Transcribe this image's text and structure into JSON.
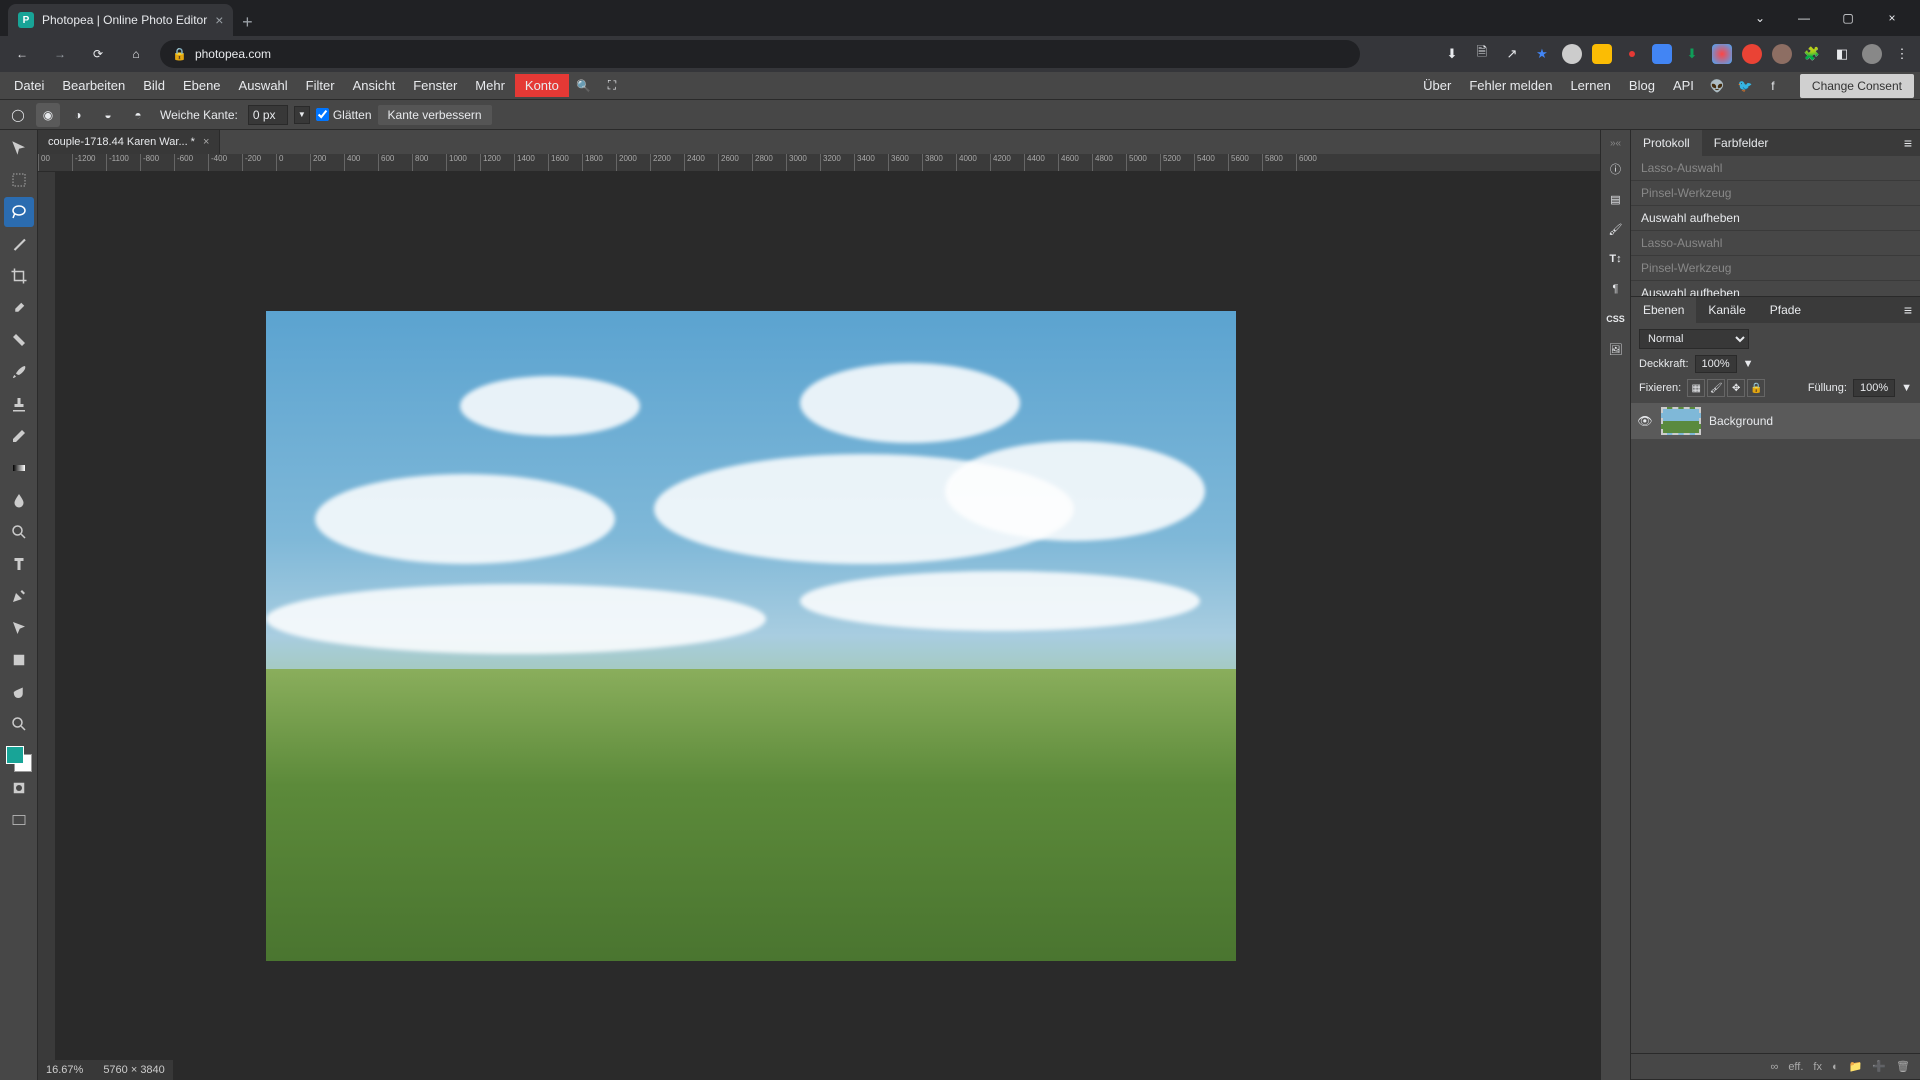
{
  "browser": {
    "tab_title": "Photopea | Online Photo Editor",
    "url": "photopea.com"
  },
  "menu": {
    "items": [
      "Datei",
      "Bearbeiten",
      "Bild",
      "Ebene",
      "Auswahl",
      "Filter",
      "Ansicht",
      "Fenster",
      "Mehr"
    ],
    "konto": "Konto",
    "right": [
      "Über",
      "Fehler melden",
      "Lernen",
      "Blog",
      "API"
    ],
    "consent": "Change Consent"
  },
  "options": {
    "feather_label": "Weiche Kante:",
    "feather_value": "0 px",
    "smooth_label": "Glätten",
    "refine": "Kante verbessern"
  },
  "doc": {
    "tab": "couple-1718.44 Karen War... *",
    "ruler_h": [
      "00",
      "-1200",
      "-1100",
      "-800",
      "-600",
      "-400",
      "-200",
      "0",
      "200",
      "400",
      "600",
      "800",
      "1000",
      "1200",
      "1400",
      "1600",
      "1800",
      "2000",
      "2200",
      "2400",
      "2600",
      "2800",
      "3000",
      "3200",
      "3400",
      "3600",
      "3800",
      "4000",
      "4200",
      "4400",
      "4600",
      "4800",
      "5000",
      "5200",
      "5400",
      "5600",
      "5800",
      "6000"
    ]
  },
  "status": {
    "zoom": "16.67%",
    "dims": "5760 × 3840"
  },
  "panels": {
    "history_tabs": [
      "Protokoll",
      "Farbfelder"
    ],
    "history": [
      {
        "label": "Lasso-Auswahl",
        "dim": true
      },
      {
        "label": "Pinsel-Werkzeug",
        "dim": true
      },
      {
        "label": "Auswahl aufheben",
        "dim": false
      },
      {
        "label": "Lasso-Auswahl",
        "dim": true
      },
      {
        "label": "Pinsel-Werkzeug",
        "dim": true
      },
      {
        "label": "Auswahl aufheben",
        "dim": false
      }
    ],
    "layer_tabs": [
      "Ebenen",
      "Kanäle",
      "Pfade"
    ],
    "blend_mode": "Normal",
    "opacity_label": "Deckkraft:",
    "opacity_value": "100%",
    "lock_label": "Fixieren:",
    "fill_label": "Füllung:",
    "fill_value": "100%",
    "layers": [
      {
        "name": "Background"
      }
    ],
    "footer_icons": [
      "∞",
      "eff.",
      "fx",
      "◐",
      "📁",
      "➕",
      "🗑"
    ]
  }
}
